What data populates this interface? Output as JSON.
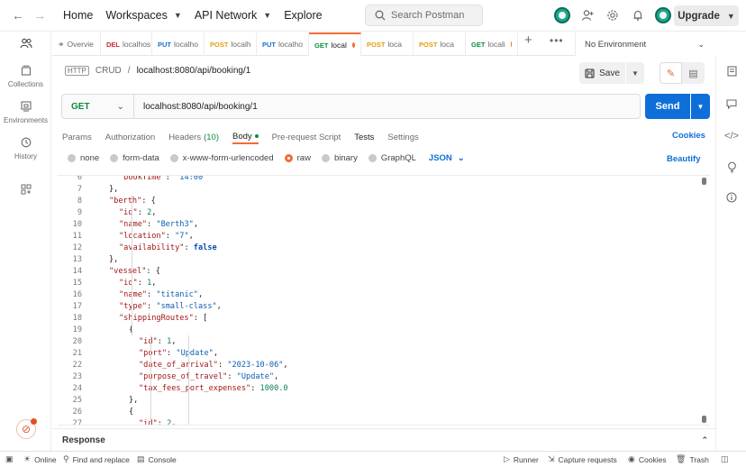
{
  "topnav": {
    "home": "Home",
    "workspaces": "Workspaces",
    "api_network": "API Network",
    "explore": "Explore",
    "search_placeholder": "Search Postman",
    "upgrade": "Upgrade"
  },
  "sidebar": {
    "items": [
      {
        "label": "",
        "icon": "people-icon"
      },
      {
        "label": "Collections",
        "icon": "collections-icon"
      },
      {
        "label": "Environments",
        "icon": "environments-icon"
      },
      {
        "label": "History",
        "icon": "history-icon"
      },
      {
        "label": "",
        "icon": "apps-icon"
      }
    ]
  },
  "tabs": [
    {
      "method": "",
      "label": "Overvie",
      "unsaved": false
    },
    {
      "method": "DEL",
      "label": "localhos",
      "unsaved": false
    },
    {
      "method": "PUT",
      "label": "localho",
      "unsaved": false
    },
    {
      "method": "POST",
      "label": "localh",
      "unsaved": false
    },
    {
      "method": "PUT",
      "label": "localho",
      "unsaved": false
    },
    {
      "method": "GET",
      "label": "local",
      "unsaved": true
    },
    {
      "method": "POST",
      "label": "loca",
      "unsaved": true
    },
    {
      "method": "POST",
      "label": "loca",
      "unsaved": true
    },
    {
      "method": "GET",
      "label": "locali",
      "unsaved": true
    }
  ],
  "environment": "No Environment",
  "breadcrumb": {
    "badge": "HTTP",
    "collection": "CRUD",
    "separator": "/",
    "request": "localhost:8080/api/booking/1"
  },
  "save_label": "Save",
  "request": {
    "method": "GET",
    "url": "localhost:8080/api/booking/1",
    "send_label": "Send"
  },
  "request_tabs": {
    "params": "Params",
    "authorization": "Authorization",
    "headers": "Headers",
    "headers_count": "(10)",
    "body": "Body",
    "prerequest": "Pre-request Script",
    "tests": "Tests",
    "settings": "Settings",
    "cookies": "Cookies"
  },
  "body_types": {
    "none": "none",
    "form_data": "form-data",
    "urlencoded": "x-www-form-urlencoded",
    "raw": "raw",
    "binary": "binary",
    "graphql": "GraphQL",
    "format": "JSON",
    "beautify": "Beautify"
  },
  "code_lines": [
    {
      "n": "6",
      "text": "\"bookTime\": \"14:00\""
    },
    {
      "n": "7",
      "text": "},"
    },
    {
      "n": "8",
      "text": "\"berth\": {"
    },
    {
      "n": "9",
      "text": "\"id\": 2,"
    },
    {
      "n": "10",
      "text": "\"name\": \"Berth3\","
    },
    {
      "n": "11",
      "text": "\"location\": \"7\","
    },
    {
      "n": "12",
      "text": "\"availability\": false"
    },
    {
      "n": "13",
      "text": "},"
    },
    {
      "n": "14",
      "text": "\"vessel\": {"
    },
    {
      "n": "15",
      "text": "\"id\": 1,"
    },
    {
      "n": "16",
      "text": "\"name\": \"titanic\","
    },
    {
      "n": "17",
      "text": "\"type\": \"small-class\","
    },
    {
      "n": "18",
      "text": "\"shippingRoutes\": ["
    },
    {
      "n": "19",
      "text": "{"
    },
    {
      "n": "20",
      "text": "\"id\": 1,"
    },
    {
      "n": "21",
      "text": "\"port\": \"Update\","
    },
    {
      "n": "22",
      "text": "\"date_of_arrival\": \"2023-10-06\","
    },
    {
      "n": "23",
      "text": "\"purpose_of_travel\": \"Update\","
    },
    {
      "n": "24",
      "text": "\"tax_fees_port_expenses\": 1000.0"
    },
    {
      "n": "25",
      "text": "},"
    },
    {
      "n": "26",
      "text": "{"
    },
    {
      "n": "27",
      "text": "\"id\": 2,"
    }
  ],
  "response_label": "Response",
  "statusbar": {
    "online": "Online",
    "find_replace": "Find and replace",
    "console": "Console",
    "runner": "Runner",
    "capture": "Capture requests",
    "cookies": "Cookies",
    "trash": "Trash"
  },
  "colors": {
    "accent": "#f26b3a",
    "primary_blue": "#0f6fd9",
    "get_green": "#0f8a3f",
    "post_orange": "#e29e0c",
    "put_blue": "#1c6fd1",
    "delete_red": "#d12828"
  }
}
